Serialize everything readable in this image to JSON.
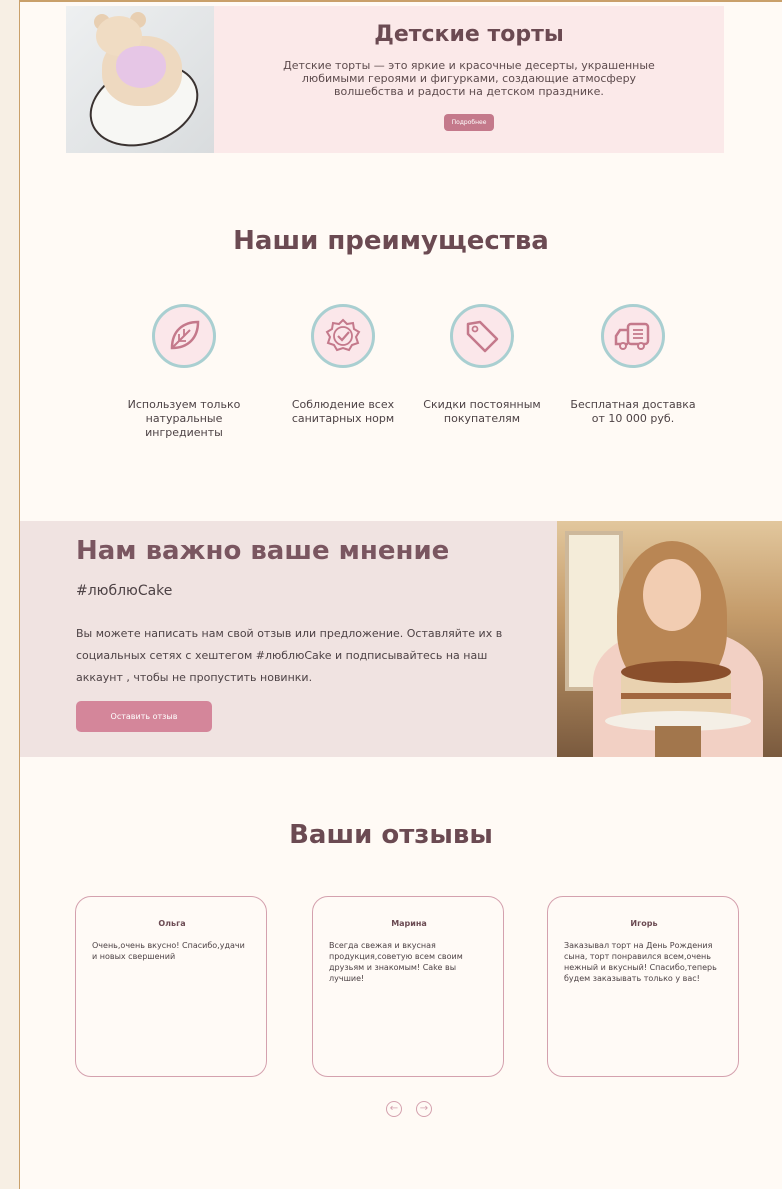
{
  "kids": {
    "title": "Детские торты",
    "text": "Детские торты — это яркие и красочные десерты, украшенные любимыми героями и фигурками, создающие атмосферу волшебства и радости на детском празднике.",
    "button": "Подробнее"
  },
  "advantages": {
    "title": "Наши преимущества",
    "items": [
      {
        "label": "Используем только натуральные ингредиенты",
        "icon": "leaf-icon"
      },
      {
        "label": "Соблюдение всех санитарных норм",
        "icon": "check-badge-icon"
      },
      {
        "label": "Скидки постоянным покупателям",
        "icon": "tag-icon"
      },
      {
        "label": "Бесплатная доставка от 10 000 руб.",
        "icon": "truck-icon"
      }
    ]
  },
  "opinion": {
    "title": "Нам важно ваше мнение",
    "hashtag": "#люблюCake",
    "text": "Вы можете написать нам свой отзыв или предложение. Оставляйте их в социальных сетях с хештегом #люблюCake и подписывайтесь на наш аккаунт , чтобы не пропустить новинки.",
    "button": "Оставить отзыв"
  },
  "reviews": {
    "title": "Ваши отзывы",
    "items": [
      {
        "name": "Ольга",
        "text": "Очень,очень вкусно! Спасибо,удачи и новых свершений"
      },
      {
        "name": "Марина",
        "text": "Всегда свежая и вкусная продукция,советую всем своим друзьям и знакомым! Cake вы лучшие!"
      },
      {
        "name": "Игорь",
        "text": "Заказывал торт на День Рождения сына, торт понравился всем,очень нежный и вкусный! Спасибо,теперь будем заказывать только у вас!"
      }
    ]
  },
  "colors": {
    "accent": "#c4798b",
    "icon_ring": "#a9cfd1",
    "page_bg": "#fffaf5"
  }
}
